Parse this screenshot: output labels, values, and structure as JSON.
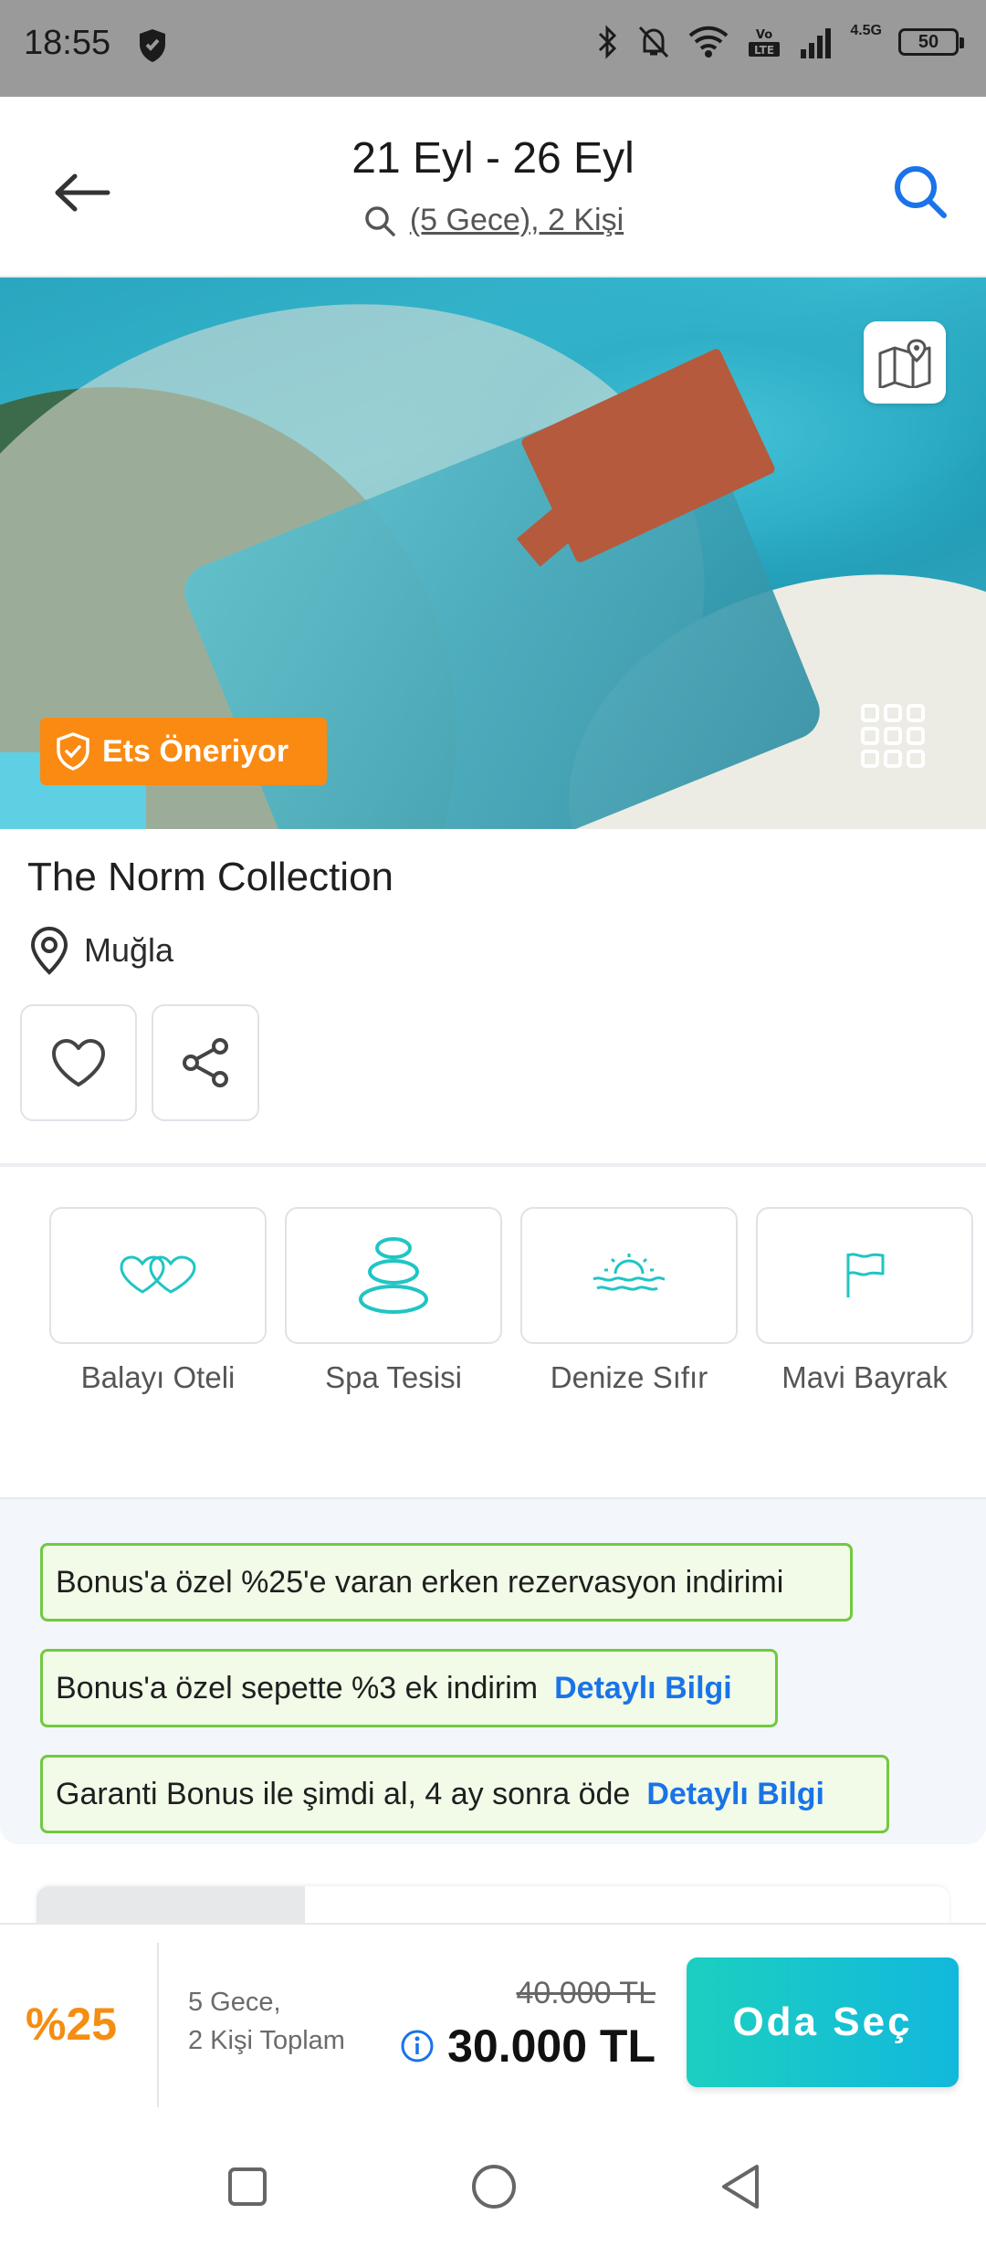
{
  "status_bar": {
    "time": "18:55",
    "network_small": "4.5G",
    "battery": "50"
  },
  "header": {
    "dates": "21 Eyl - 26 Eyl",
    "subtitle": "(5 Gece), 2 Kişi"
  },
  "hero": {
    "badge": "Ets Öneriyor"
  },
  "hotel": {
    "name": "The Norm Collection",
    "location": "Muğla"
  },
  "features": [
    {
      "label": "Balayı Oteli",
      "icon": "hearts-icon"
    },
    {
      "label": "Spa Tesisi",
      "icon": "spa-stones-icon"
    },
    {
      "label": "Denize Sıfır",
      "icon": "sea-sun-icon"
    },
    {
      "label": "Mavi Bayrak",
      "icon": "flag-icon"
    }
  ],
  "promos": [
    {
      "text": "Bonus'a özel %25'e varan erken rezervasyon indirimi",
      "link": ""
    },
    {
      "text": "Bonus'a özel sepette %3 ek indirim",
      "link": "Detaylı Bilgi"
    },
    {
      "text": "Garanti Bonus ile şimdi al, 4 ay sonra öde",
      "link": "Detaylı Bilgi"
    }
  ],
  "booking": {
    "discount": "%25",
    "nights_line1": "5 Gece,",
    "nights_line2": "2 Kişi Toplam",
    "old_price": "40.000 TL",
    "price": "30.000 TL",
    "cta": "Oda Seç"
  },
  "colors": {
    "accent_blue": "#1a73e8",
    "teal": "#20c5c4",
    "orange": "#fa8a12",
    "promo_green": "#72c93e"
  }
}
